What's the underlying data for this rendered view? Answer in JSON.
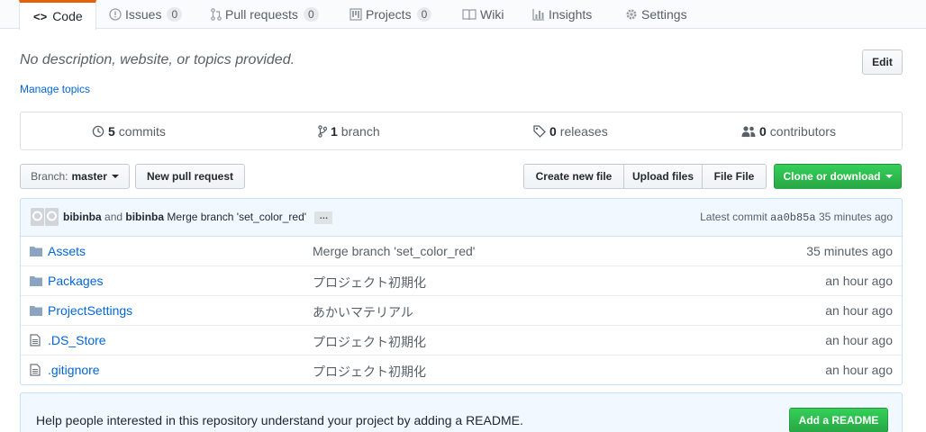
{
  "tabs": [
    {
      "label": "Code",
      "icon": "code-icon",
      "selected": true
    },
    {
      "label": "Issues",
      "icon": "issue-opened-icon",
      "count": "0"
    },
    {
      "label": "Pull requests",
      "icon": "git-pull-request-icon",
      "count": "0"
    },
    {
      "label": "Projects",
      "icon": "project-icon",
      "count": "0"
    },
    {
      "label": "Wiki",
      "icon": "book-icon"
    },
    {
      "label": "Insights",
      "icon": "graph-icon"
    },
    {
      "label": "Settings",
      "icon": "gear-icon"
    }
  ],
  "repo": {
    "description": "No description, website, or topics provided.",
    "manage_topics": "Manage topics",
    "edit_label": "Edit"
  },
  "summary": {
    "commits_count": "5",
    "commits_label": "commits",
    "branch_count": "1",
    "branch_label": "branch",
    "releases_count": "0",
    "releases_label": "releases",
    "contributors_count": "0",
    "contributors_label": "contributors"
  },
  "toolbar": {
    "branch_prefix": "Branch:",
    "branch_name": "master",
    "new_pr": "New pull request",
    "create_file": "Create new file",
    "upload_files": "Upload files",
    "find_file": "File File",
    "clone": "Clone or download"
  },
  "commit": {
    "author": "bibinba",
    "and": "and",
    "committer": "bibinba",
    "message": "Merge branch 'set_color_red'",
    "ellipsis": "…",
    "latest_label": "Latest commit",
    "sha": "aa0b85a",
    "age": "35 minutes ago"
  },
  "files": [
    {
      "name": "Assets",
      "type": "folder",
      "message": "Merge branch 'set_color_red'",
      "age": "35 minutes ago"
    },
    {
      "name": "Packages",
      "type": "folder",
      "message": "プロジェクト初期化",
      "age": "an hour ago"
    },
    {
      "name": "ProjectSettings",
      "type": "folder",
      "message": "あかいマテリアル",
      "age": "an hour ago"
    },
    {
      "name": ".DS_Store",
      "type": "file",
      "message": "プロジェクト初期化",
      "age": "an hour ago"
    },
    {
      "name": ".gitignore",
      "type": "file",
      "message": "プロジェクト初期化",
      "age": "an hour ago"
    }
  ],
  "readme": {
    "prompt": "Help people interested in this repository understand your project by adding a README.",
    "button": "Add a README"
  },
  "colors": {
    "link": "#0366d6",
    "accent_tab": "#e36209",
    "green_button": "#28a745",
    "info_bg": "#f1f8ff"
  }
}
